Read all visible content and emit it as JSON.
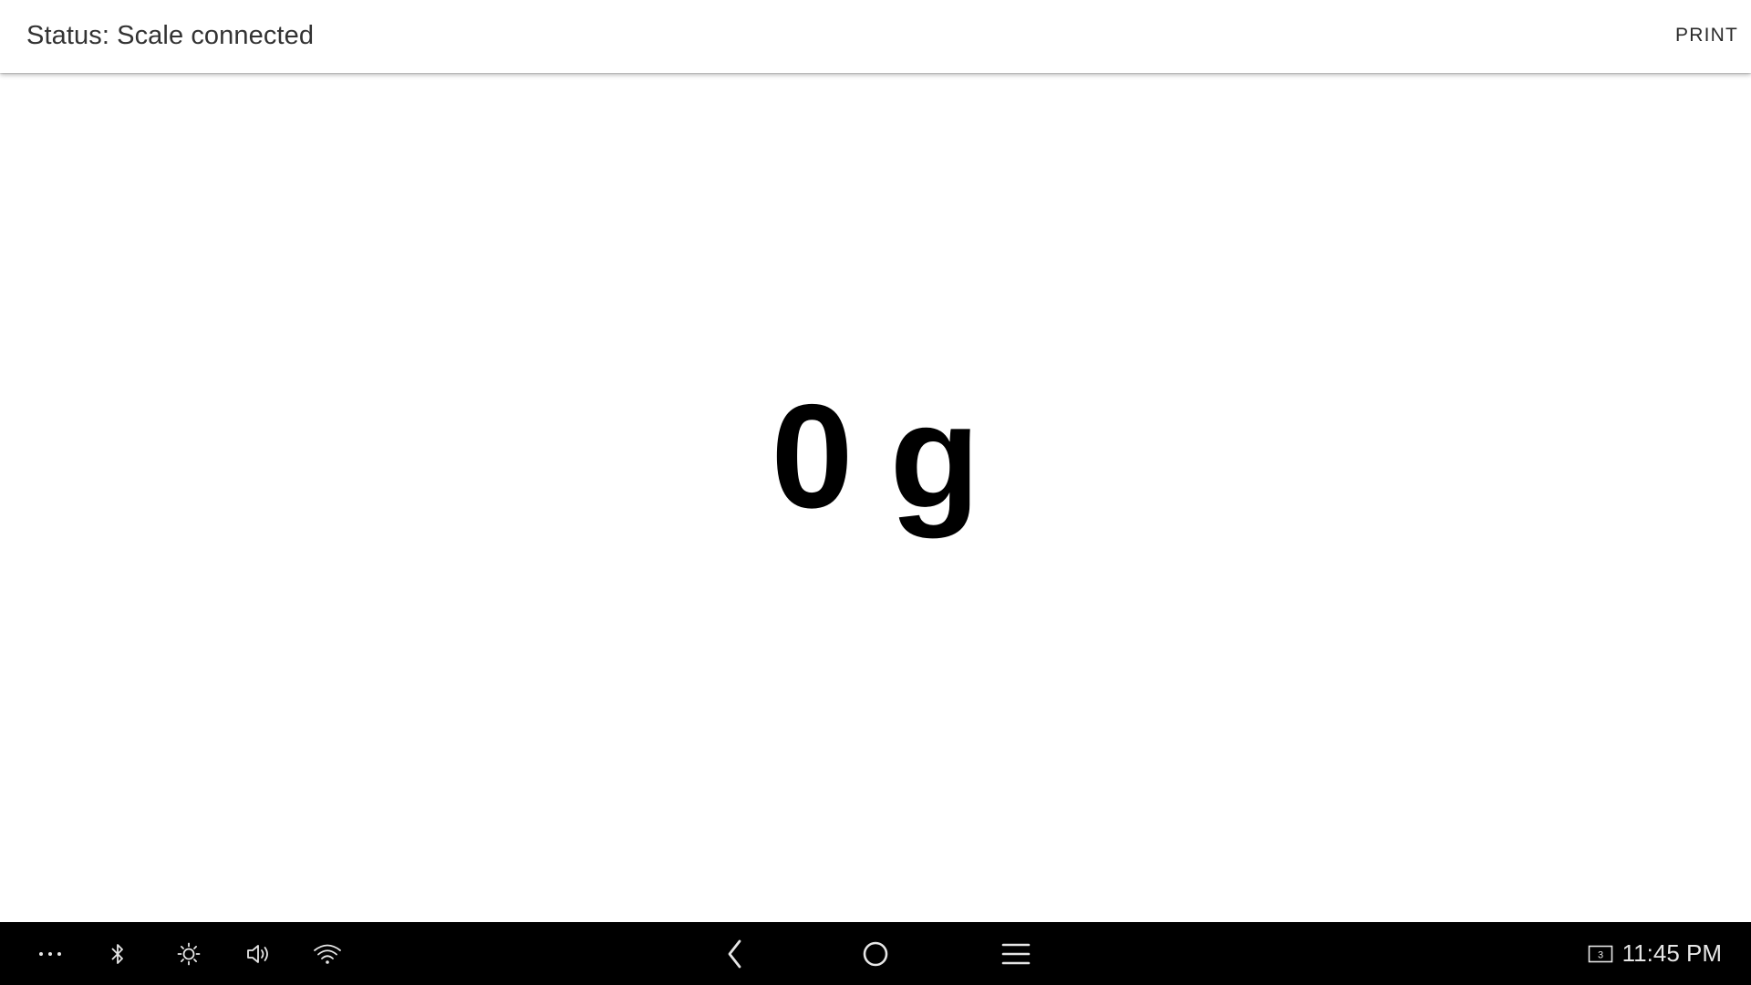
{
  "header": {
    "status_text": "Status: Scale connected",
    "print_label": "PRINT"
  },
  "scale": {
    "value": "0",
    "unit": "g"
  },
  "system_bar": {
    "left_icons": [
      "more-icon",
      "bluetooth-icon",
      "brightness-icon",
      "volume-icon",
      "wifi-icon"
    ],
    "center_icons": [
      "back-icon",
      "home-icon",
      "menu-icon"
    ],
    "screen_badge_number": "3",
    "time": "11:45 PM"
  },
  "colors": {
    "background": "#ffffff",
    "nav_bar": "#000000",
    "nav_icon": "#e6e6e6",
    "weight_text": "#000000"
  }
}
